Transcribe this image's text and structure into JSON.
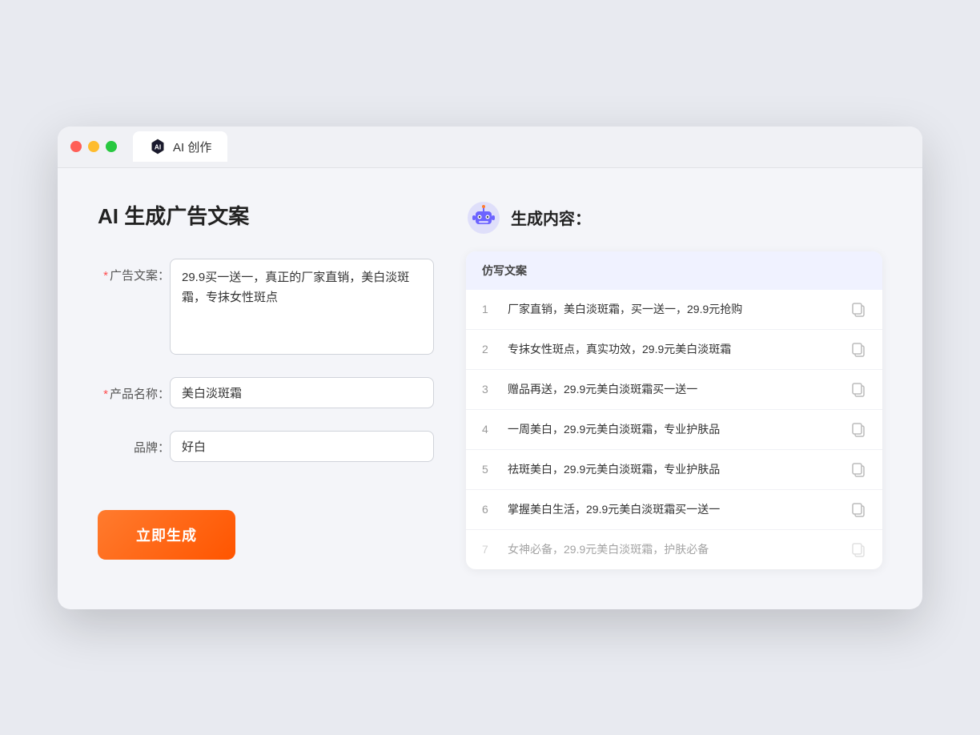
{
  "window": {
    "tab_label": "AI 创作"
  },
  "left_panel": {
    "title": "AI 生成广告文案",
    "ad_copy_label": "广告文案：",
    "ad_copy_required": true,
    "ad_copy_value": "29.9买一送一，真正的厂家直销，美白淡斑霜，专抹女性斑点",
    "product_name_label": "产品名称：",
    "product_name_required": true,
    "product_name_value": "美白淡斑霜",
    "brand_label": "品牌：",
    "brand_required": false,
    "brand_value": "好白",
    "generate_button": "立即生成"
  },
  "right_panel": {
    "title": "生成内容：",
    "table_header": "仿写文案",
    "results": [
      {
        "num": 1,
        "text": "厂家直销，美白淡斑霜，买一送一，29.9元抢购",
        "faded": false
      },
      {
        "num": 2,
        "text": "专抹女性斑点，真实功效，29.9元美白淡斑霜",
        "faded": false
      },
      {
        "num": 3,
        "text": "赠品再送，29.9元美白淡斑霜买一送一",
        "faded": false
      },
      {
        "num": 4,
        "text": "一周美白，29.9元美白淡斑霜，专业护肤品",
        "faded": false
      },
      {
        "num": 5,
        "text": "祛斑美白，29.9元美白淡斑霜，专业护肤品",
        "faded": false
      },
      {
        "num": 6,
        "text": "掌握美白生活，29.9元美白淡斑霜买一送一",
        "faded": false
      },
      {
        "num": 7,
        "text": "女神必备，29.9元美白淡斑霜，护肤必备",
        "faded": true
      }
    ]
  }
}
